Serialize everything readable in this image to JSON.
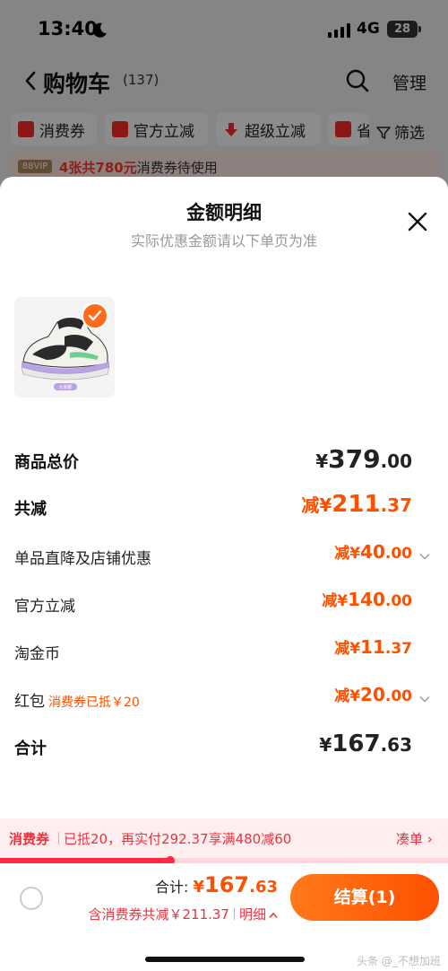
{
  "status_bar": {
    "time": "13:40",
    "network": "4G",
    "battery": "28"
  },
  "nav": {
    "title": "购物车",
    "count": "(137)",
    "manage": "管理"
  },
  "filters": {
    "chips": [
      "消费券",
      "官方立减",
      "超级立减",
      "省"
    ],
    "filter_label": "筛选"
  },
  "vip_strip": {
    "badge": "88VIP",
    "highlight": "4张共780元",
    "text": "消费券待使用"
  },
  "sheet": {
    "title": "金额明细",
    "subtitle": "实际优惠金额请以下单页为准",
    "product_tag": "大家都"
  },
  "rows": {
    "subtotal": {
      "label": "商品总价",
      "symbol": "¥",
      "int": "379",
      "dec": ".00"
    },
    "total_discount": {
      "label": "共减",
      "prefix": "减",
      "symbol": "¥",
      "int": "211",
      "dec": ".37"
    },
    "store_discount": {
      "label": "单品直降及店铺优惠",
      "prefix": "减",
      "symbol": "¥",
      "int": "40",
      "dec": ".00"
    },
    "official_discount": {
      "label": "官方立减",
      "prefix": "减",
      "symbol": "¥",
      "int": "140",
      "dec": ".00"
    },
    "gold_coin": {
      "label": "淘金币",
      "prefix": "减",
      "symbol": "¥",
      "int": "11",
      "dec": ".37"
    },
    "red_packet": {
      "label": "红包",
      "sub": "消费券已抵￥20",
      "prefix": "减",
      "symbol": "¥",
      "int": "20",
      "dec": ".00"
    },
    "total": {
      "label": "合计",
      "symbol": "¥",
      "int": "167",
      "dec": ".63"
    }
  },
  "coupon_bar": {
    "tag": "消费券",
    "message": "已抵20，再实付292.37享满480减60",
    "action": "凑单 ›",
    "progress": 0.38
  },
  "checkout": {
    "total_label": "合计: ",
    "symbol": "¥",
    "int": "167",
    "dec": ".63",
    "discount_text": "含消费券共减￥211.37",
    "detail_label": "明细",
    "button_label": "结算(1)",
    "watermark": "头条 @_不想加班"
  },
  "colors": {
    "accent": "#ff5000",
    "coupon_red": "#e8343f",
    "badge_red": "#ff2a2a"
  }
}
